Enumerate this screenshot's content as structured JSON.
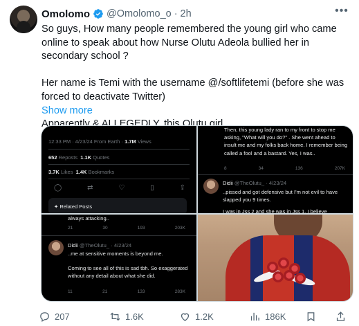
{
  "tweet": {
    "author_name": "Omolomo",
    "author_handle": "@Omolomo_o",
    "separator": "·",
    "time": "2h",
    "paragraphs": [
      "So guys, How many people remembered the young girl who came online to speak about how Nurse Olutu Adeola bullied her in secondary school ?",
      "Her name is Temi with the username @/softlifetemi (before she was forced to deactivate Twitter)",
      "Apparently & ALLEGEDLY, this Olutu girl…"
    ],
    "show_more": "Show more"
  },
  "media": {
    "shot1": {
      "meta_time": "12:33 PM · 4/23/24 From Earth ·",
      "meta_views_num": "1.7M",
      "meta_views": "Views",
      "reposts_num": "652",
      "reposts": "Reposts",
      "quotes_num": "1.1K",
      "quotes": "Quotes",
      "likes_num": "3.7K",
      "likes": "Likes",
      "bookmarks_num": "1.4K",
      "bookmarks": "Bookmarks",
      "related": "Related Posts"
    },
    "shot2": {
      "text": "Then, this young lady ran to my front to stop me asking, \"What will you do?\" . She went ahead to insult me and my folks back home. I remember being called a fool and a bastard. Yes, I was..",
      "stats": [
        "8",
        "34",
        "136",
        "207K"
      ],
      "reply_name": "Didii",
      "reply_handle": "@TheOlutu_ · 4/23/24",
      "reply_text": "..pissed and got defensive but I'm not evil to have slapped you 9 times.",
      "reply_more": "I was in Jss 2 and she was in Jss 1. I believe"
    },
    "shot3": {
      "top_text": "always attacking..",
      "stats_top": [
        "21",
        "30",
        "193",
        "203K"
      ],
      "reply_name": "Didii",
      "reply_handle": "@TheOlutu_ · 4/23/24",
      "line1": "..me at sensitive moments is beyond me.",
      "line2": "Coming to see all of this is sad tbh. So exaggerated without any detail about what she did.",
      "stats_bottom": [
        "11",
        "21",
        "133",
        "283K"
      ]
    }
  },
  "actions": {
    "replies": "207",
    "reposts": "1.6K",
    "likes": "1.2K",
    "views": "186K"
  },
  "colors": {
    "accent": "#1d9bf0",
    "text": "#0f1419",
    "muted": "#536471"
  }
}
